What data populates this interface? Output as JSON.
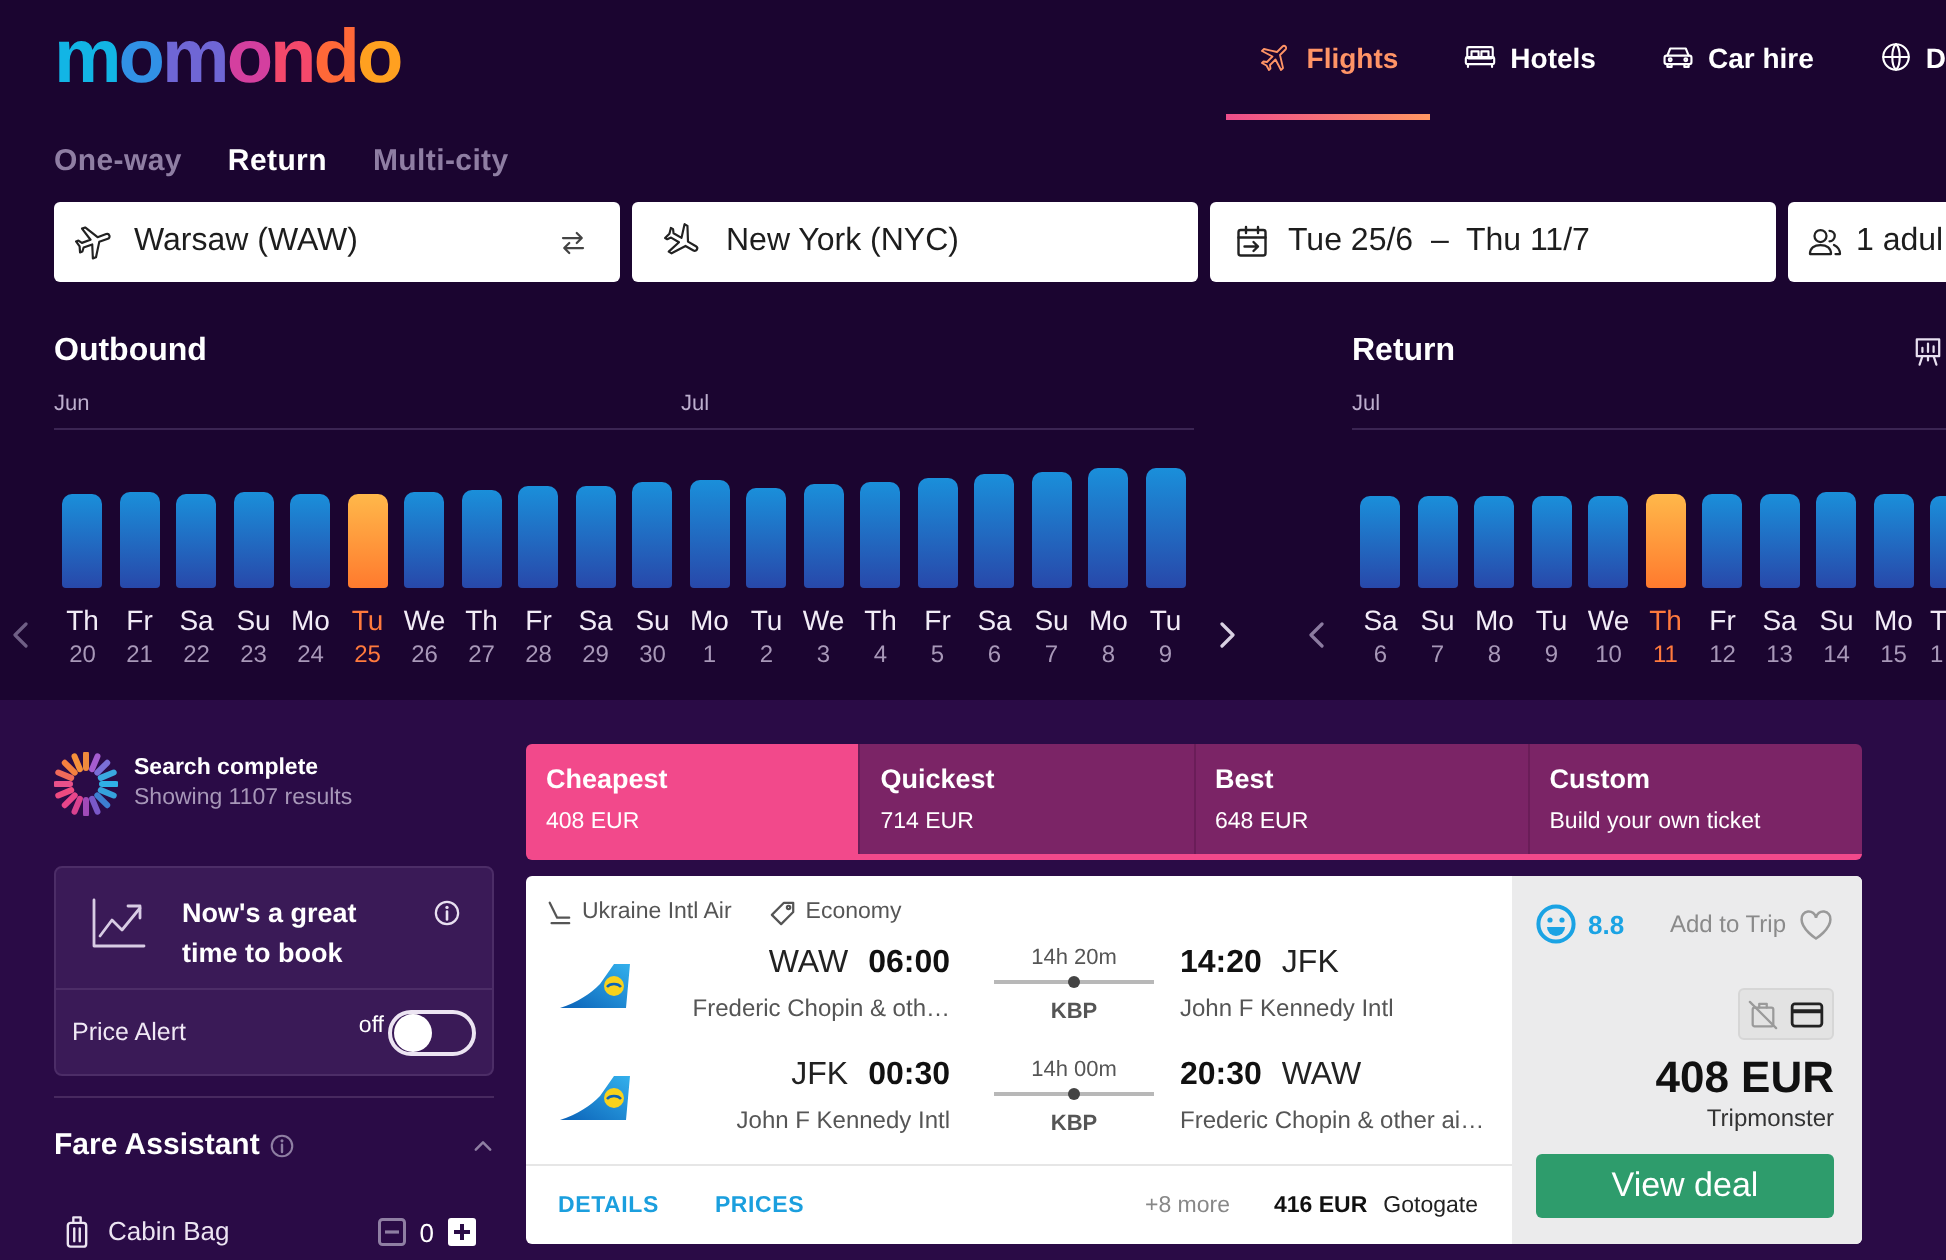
{
  "header": {
    "logo": "momondo",
    "nav": [
      {
        "label": "Flights",
        "selected": true
      },
      {
        "label": "Hotels",
        "selected": false
      },
      {
        "label": "Car hire",
        "selected": false
      },
      {
        "label": "D",
        "selected": false
      }
    ]
  },
  "trip_types": [
    {
      "label": "One-way",
      "selected": false
    },
    {
      "label": "Return",
      "selected": true
    },
    {
      "label": "Multi-city",
      "selected": false
    }
  ],
  "search": {
    "origin": "Warsaw (WAW)",
    "destination": "New York (NYC)",
    "dates": "Tue 25/6  –  Thu 11/7",
    "travellers": "1 adul"
  },
  "outbound": {
    "title": "Outbound",
    "days": [
      {
        "day": "Th",
        "date": "20",
        "month": "Jun",
        "selected": false
      },
      {
        "day": "Fr",
        "date": "21",
        "selected": false
      },
      {
        "day": "Sa",
        "date": "22",
        "selected": false
      },
      {
        "day": "Su",
        "date": "23",
        "selected": false
      },
      {
        "day": "Mo",
        "date": "24",
        "selected": false
      },
      {
        "day": "Tu",
        "date": "25",
        "selected": true
      },
      {
        "day": "We",
        "date": "26",
        "selected": false
      },
      {
        "day": "Th",
        "date": "27",
        "selected": false
      },
      {
        "day": "Fr",
        "date": "28",
        "selected": false
      },
      {
        "day": "Sa",
        "date": "29",
        "selected": false
      },
      {
        "day": "Su",
        "date": "30",
        "selected": false
      },
      {
        "day": "Mo",
        "date": "1",
        "month": "Jul",
        "selected": false
      },
      {
        "day": "Tu",
        "date": "2",
        "selected": false
      },
      {
        "day": "We",
        "date": "3",
        "selected": false
      },
      {
        "day": "Th",
        "date": "4",
        "selected": false
      },
      {
        "day": "Fr",
        "date": "5",
        "selected": false
      },
      {
        "day": "Sa",
        "date": "6",
        "selected": false
      },
      {
        "day": "Su",
        "date": "7",
        "selected": false
      },
      {
        "day": "Mo",
        "date": "8",
        "selected": false
      },
      {
        "day": "Tu",
        "date": "9",
        "selected": false
      }
    ]
  },
  "return": {
    "title": "Return",
    "days": [
      {
        "day": "Sa",
        "date": "6",
        "month": "Jul",
        "selected": false
      },
      {
        "day": "Su",
        "date": "7",
        "selected": false
      },
      {
        "day": "Mo",
        "date": "8",
        "selected": false
      },
      {
        "day": "Tu",
        "date": "9",
        "selected": false
      },
      {
        "day": "We",
        "date": "10",
        "selected": false
      },
      {
        "day": "Th",
        "date": "11",
        "selected": true
      },
      {
        "day": "Fr",
        "date": "12",
        "selected": false
      },
      {
        "day": "Sa",
        "date": "13",
        "selected": false
      },
      {
        "day": "Su",
        "date": "14",
        "selected": false
      },
      {
        "day": "Mo",
        "date": "15",
        "selected": false
      },
      {
        "day": "T",
        "date": "1",
        "selected": false
      }
    ]
  },
  "status": {
    "title": "Search complete",
    "detail": "Showing 1107 results"
  },
  "price_insight": {
    "message": "Now's a great time to book",
    "alert_label": "Price Alert",
    "alert_state": "off",
    "alert_on": false
  },
  "fare_assistant": {
    "title": "Fare Assistant",
    "expanded": true,
    "items": [
      {
        "label": "Cabin Bag",
        "count": "0"
      }
    ]
  },
  "sort_tabs": [
    {
      "label": "Cheapest",
      "detail": "408 EUR",
      "selected": true
    },
    {
      "label": "Quickest",
      "detail": "714 EUR",
      "selected": false
    },
    {
      "label": "Best",
      "detail": "648 EUR",
      "selected": false
    },
    {
      "label": "Custom",
      "detail": "Build your own ticket",
      "selected": false
    }
  ],
  "result": {
    "airline": "Ukraine Intl Air",
    "cabin": "Economy",
    "legs": [
      {
        "from_code": "WAW",
        "depart": "06:00",
        "from_airport": "Frederic Chopin & oth…",
        "duration": "14h 20m",
        "stop": "KBP",
        "arrive": "14:20",
        "to_code": "JFK",
        "to_airport": "John F Kennedy Intl"
      },
      {
        "from_code": "JFK",
        "depart": "00:30",
        "from_airport": "John F Kennedy Intl",
        "duration": "14h 00m",
        "stop": "KBP",
        "arrive": "20:30",
        "to_code": "WAW",
        "to_airport": "Frederic Chopin & other ai…"
      }
    ],
    "links": [
      "DETAILS",
      "PRICES"
    ],
    "more": "+8 more",
    "alt_price": "416 EUR",
    "alt_provider": "Gotogate",
    "score": "8.8",
    "add_to_trip": "Add to Trip",
    "price": "408 EUR",
    "provider": "Tripmonster",
    "action": "View deal"
  }
}
